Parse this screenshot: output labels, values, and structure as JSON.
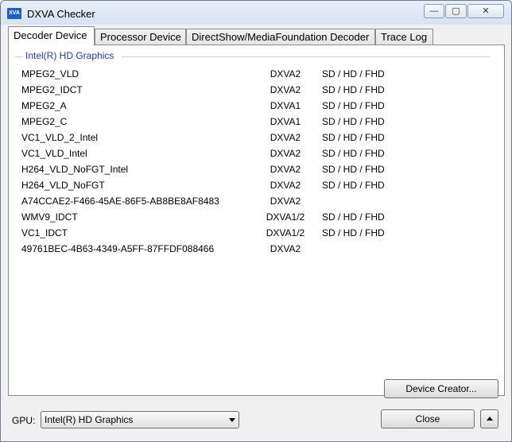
{
  "window": {
    "title": "DXVA Checker",
    "icon_text": "XVA",
    "controls": {
      "minimize": "—",
      "maximize": "▢",
      "close": "✕"
    }
  },
  "tabs": [
    {
      "label": "Decoder Device",
      "active": true
    },
    {
      "label": "Processor Device",
      "active": false
    },
    {
      "label": "DirectShow/MediaFoundation Decoder",
      "active": false
    },
    {
      "label": "Trace Log",
      "active": false
    }
  ],
  "decoder_list": {
    "group_title": "Intel(R) HD Graphics",
    "rows": [
      {
        "name": "MPEG2_VLD",
        "api": "DXVA2",
        "resolutions": "SD / HD / FHD"
      },
      {
        "name": "MPEG2_IDCT",
        "api": "DXVA2",
        "resolutions": "SD / HD / FHD"
      },
      {
        "name": "MPEG2_A",
        "api": "DXVA1",
        "resolutions": "SD / HD / FHD"
      },
      {
        "name": "MPEG2_C",
        "api": "DXVA1",
        "resolutions": "SD / HD / FHD"
      },
      {
        "name": "VC1_VLD_2_Intel",
        "api": "DXVA2",
        "resolutions": "SD / HD / FHD"
      },
      {
        "name": "VC1_VLD_Intel",
        "api": "DXVA2",
        "resolutions": "SD / HD / FHD"
      },
      {
        "name": "H264_VLD_NoFGT_Intel",
        "api": "DXVA2",
        "resolutions": "SD / HD / FHD"
      },
      {
        "name": "H264_VLD_NoFGT",
        "api": "DXVA2",
        "resolutions": "SD / HD / FHD"
      },
      {
        "name": "A74CCAE2-F466-45AE-86F5-AB8BE8AF8483",
        "api": "DXVA2",
        "resolutions": ""
      },
      {
        "name": "WMV9_IDCT",
        "api": "DXVA1/2",
        "resolutions": "SD / HD / FHD"
      },
      {
        "name": "VC1_IDCT",
        "api": "DXVA1/2",
        "resolutions": "SD / HD / FHD"
      },
      {
        "name": "49761BEC-4B63-4349-A5FF-87FFDF088466",
        "api": "DXVA2",
        "resolutions": ""
      }
    ]
  },
  "footer": {
    "device_creator_label": "Device Creator...",
    "gpu_label": "GPU:",
    "gpu_selected": "Intel(R) HD Graphics",
    "close_label": "Close"
  }
}
